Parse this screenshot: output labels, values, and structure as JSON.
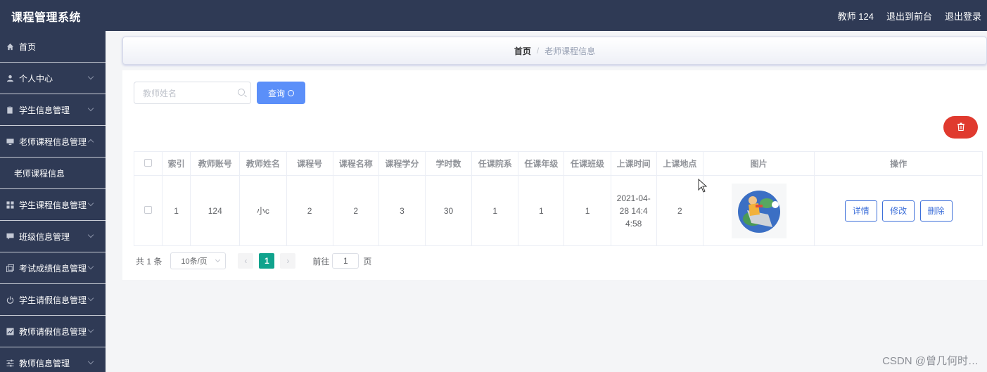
{
  "header": {
    "brand": "课程管理系统",
    "user": "教师 124",
    "to_front": "退出到前台",
    "logout": "退出登录"
  },
  "sidebar": {
    "items": [
      {
        "label": "首页",
        "icon": "home-icon",
        "expanded": false,
        "has_children": false
      },
      {
        "label": "个人中心",
        "icon": "user-icon",
        "expanded": false,
        "has_children": true
      },
      {
        "label": "学生信息管理",
        "icon": "clipboard-icon",
        "expanded": false,
        "has_children": true
      },
      {
        "label": "老师课程信息管理",
        "icon": "monitor-icon",
        "expanded": true,
        "has_children": true
      },
      {
        "label": "老师课程信息",
        "icon": "",
        "sub": true
      },
      {
        "label": "学生课程信息管理",
        "icon": "grid-icon",
        "expanded": false,
        "has_children": true
      },
      {
        "label": "班级信息管理",
        "icon": "chat-icon",
        "expanded": false,
        "has_children": true
      },
      {
        "label": "考试成绩信息管理",
        "icon": "copy-icon",
        "expanded": false,
        "has_children": true
      },
      {
        "label": "学生请假信息管理",
        "icon": "power-icon",
        "expanded": false,
        "has_children": true
      },
      {
        "label": "教师请假信息管理",
        "icon": "chart-icon",
        "expanded": false,
        "has_children": true
      },
      {
        "label": "教师信息管理",
        "icon": "sliders-icon",
        "expanded": false,
        "has_children": true
      }
    ]
  },
  "breadcrumb": {
    "home": "首页",
    "separator": "/",
    "current": "老师课程信息"
  },
  "search": {
    "placeholder": "教师姓名",
    "button_label": "查询"
  },
  "table": {
    "columns": [
      "索引",
      "教师账号",
      "教师姓名",
      "课程号",
      "课程名称",
      "课程学分",
      "学时数",
      "任课院系",
      "任课年级",
      "任课班级",
      "上课时间",
      "上课地点",
      "图片",
      "操作"
    ],
    "rows": [
      {
        "index": "1",
        "account": "124",
        "name": "小c",
        "course_no": "2",
        "course_name": "2",
        "credit": "3",
        "hours": "30",
        "dept": "1",
        "grade": "1",
        "class": "1",
        "time": "2021-04-28 14:44:58",
        "place": "2"
      }
    ],
    "actions": {
      "detail": "详情",
      "edit": "修改",
      "delete": "删除"
    }
  },
  "pagination": {
    "total": "共 1 条",
    "page_size": "10条/页",
    "current_page": "1",
    "goto_label": "前往",
    "goto_value": "1",
    "page_suffix": "页"
  },
  "watermark": "CSDN @曾几何时…",
  "colors": {
    "sidebar_bg": "#2f3a55",
    "primary": "#5b8ff9",
    "danger": "#e03a2f",
    "active_page": "#10a38d"
  }
}
